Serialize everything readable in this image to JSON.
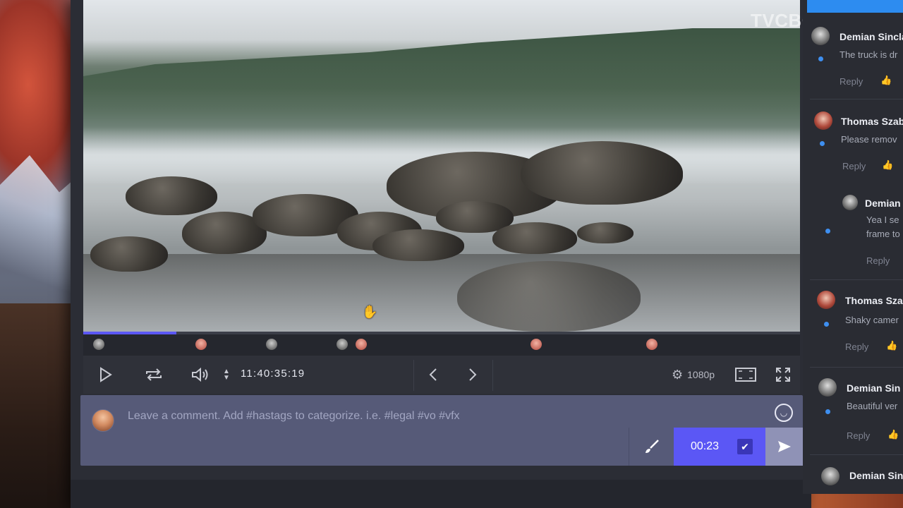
{
  "watermark": "TVCBOOK.com",
  "player": {
    "timecode": "11:40:35:19",
    "quality": "1080p",
    "progress_fraction": 0.13
  },
  "composer": {
    "placeholder": "Leave a comment. Add #hastags to categorize. i.e. #legal #vo #vfx",
    "timestamp": "00:23"
  },
  "comments": [
    {
      "name": "Demian Sincla",
      "text": [
        "The truck is dr"
      ],
      "reply": "Reply"
    },
    {
      "name": "Thomas Szab",
      "text": [
        "Please remov"
      ],
      "reply": "Reply"
    },
    {
      "name": "Demian",
      "text": [
        "Yea I se",
        "frame to"
      ],
      "reply": "Reply"
    },
    {
      "name": "Thomas Sza",
      "text": [
        "Shaky camer"
      ],
      "reply": "Reply"
    },
    {
      "name": "Demian Sin",
      "text": [
        "Beautiful ver"
      ],
      "reply": "Reply"
    },
    {
      "name": "Demian Sin",
      "text": [],
      "reply": ""
    }
  ],
  "icons": {
    "play": "play-icon",
    "loop": "loop-icon",
    "volume": "volume-icon",
    "prev": "chevron-left-icon",
    "next": "chevron-right-icon",
    "settings": "gear-icon",
    "safe_area": "frame-guide-icon",
    "fullscreen": "fullscreen-icon",
    "emoji": "smile-icon",
    "brush": "brush-icon",
    "check": "check-icon",
    "send": "send-icon",
    "like": "thumbs-up-icon"
  },
  "colors": {
    "accent": "#5b57f5",
    "panel_accent": "#2d8cf0",
    "composer_bg": "#565a78"
  }
}
